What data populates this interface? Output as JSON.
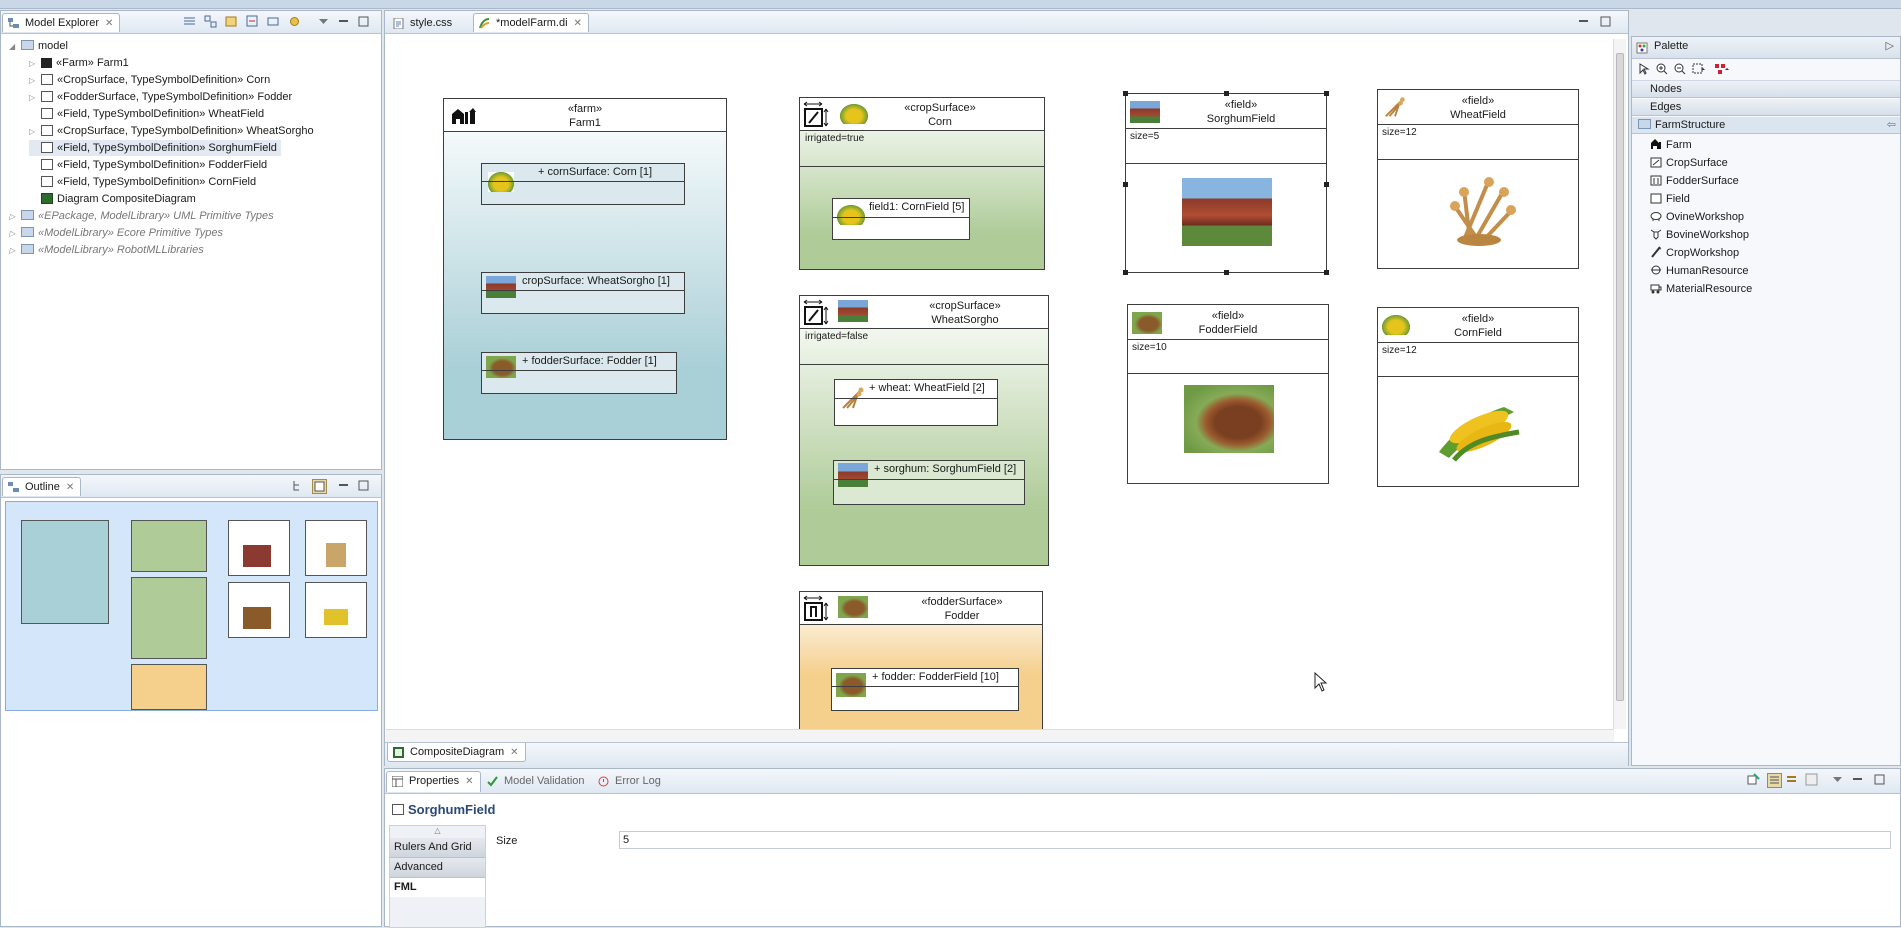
{
  "model_explorer": {
    "tab_label": "Model Explorer",
    "items": [
      {
        "label": "model"
      },
      {
        "label": "«Farm» Farm1"
      },
      {
        "label": "«CropSurface, TypeSymbolDefinition» Corn"
      },
      {
        "label": "«FodderSurface, TypeSymbolDefinition» Fodder"
      },
      {
        "label": "«Field, TypeSymbolDefinition» WheatField"
      },
      {
        "label": "«CropSurface, TypeSymbolDefinition» WheatSorgho"
      },
      {
        "label": "«Field, TypeSymbolDefinition» SorghumField"
      },
      {
        "label": "«Field, TypeSymbolDefinition» FodderField"
      },
      {
        "label": "«Field, TypeSymbolDefinition» CornField"
      },
      {
        "label": "Diagram CompositeDiagram"
      },
      {
        "label": "«EPackage, ModelLibrary» UML Primitive Types"
      },
      {
        "label": "«ModelLibrary» Ecore Primitive Types"
      },
      {
        "label": "«ModelLibrary» RobotMLLibraries"
      }
    ]
  },
  "outline": {
    "tab_label": "Outline"
  },
  "editor": {
    "tabs": [
      {
        "label": "style.css"
      },
      {
        "label": "*modelFarm.di"
      }
    ],
    "bottom_tab": "CompositeDiagram"
  },
  "diagram": {
    "farm": {
      "stereotype": "«farm»",
      "name": "Farm1",
      "parts": [
        "+ cornSurface: Corn [1]",
        "cropSurface: WheatSorgho [1]",
        "+ fodderSurface: Fodder [1]"
      ]
    },
    "corn": {
      "stereotype": "«cropSurface»",
      "name": "Corn",
      "prop": "irrigated=true",
      "parts": [
        "field1: CornField [5]"
      ]
    },
    "wheatsorgho": {
      "stereotype": "«cropSurface»",
      "name": "WheatSorgho",
      "prop": "irrigated=false",
      "parts": [
        "+ wheat: WheatField [2]",
        "+ sorghum: SorghumField [2]"
      ]
    },
    "fodder": {
      "stereotype": "«fodderSurface»",
      "name": "Fodder",
      "parts": [
        "+ fodder: FodderField [10]"
      ]
    },
    "sorghumfield": {
      "stereotype": "«field»",
      "name": "SorghumField",
      "prop": "size=5"
    },
    "wheatfield": {
      "stereotype": "«field»",
      "name": "WheatField",
      "prop": "size=12"
    },
    "fodderfield": {
      "stereotype": "«field»",
      "name": "FodderField",
      "prop": "size=10"
    },
    "cornfield": {
      "stereotype": "«field»",
      "name": "CornField",
      "prop": "size=12"
    }
  },
  "palette": {
    "title": "Palette",
    "categories": [
      "Nodes",
      "Edges",
      "FarmStructure"
    ],
    "items": [
      "Farm",
      "CropSurface",
      "FodderSurface",
      "Field",
      "OvineWorkshop",
      "BovineWorkshop",
      "CropWorkshop",
      "HumanResource",
      "MaterialResource"
    ]
  },
  "properties": {
    "tabs": [
      "Properties",
      "Model Validation",
      "Error Log"
    ],
    "title": "SorghumField",
    "sections": [
      "Rulers And Grid",
      "Advanced",
      "FML"
    ],
    "field_label": "Size",
    "field_value": "5"
  },
  "colors": {
    "farm_fill": "#a9cfd7",
    "crop_fill": "#aecb98",
    "fodder_fill": "#f5cf8c",
    "selection": "#3f7bd4"
  }
}
